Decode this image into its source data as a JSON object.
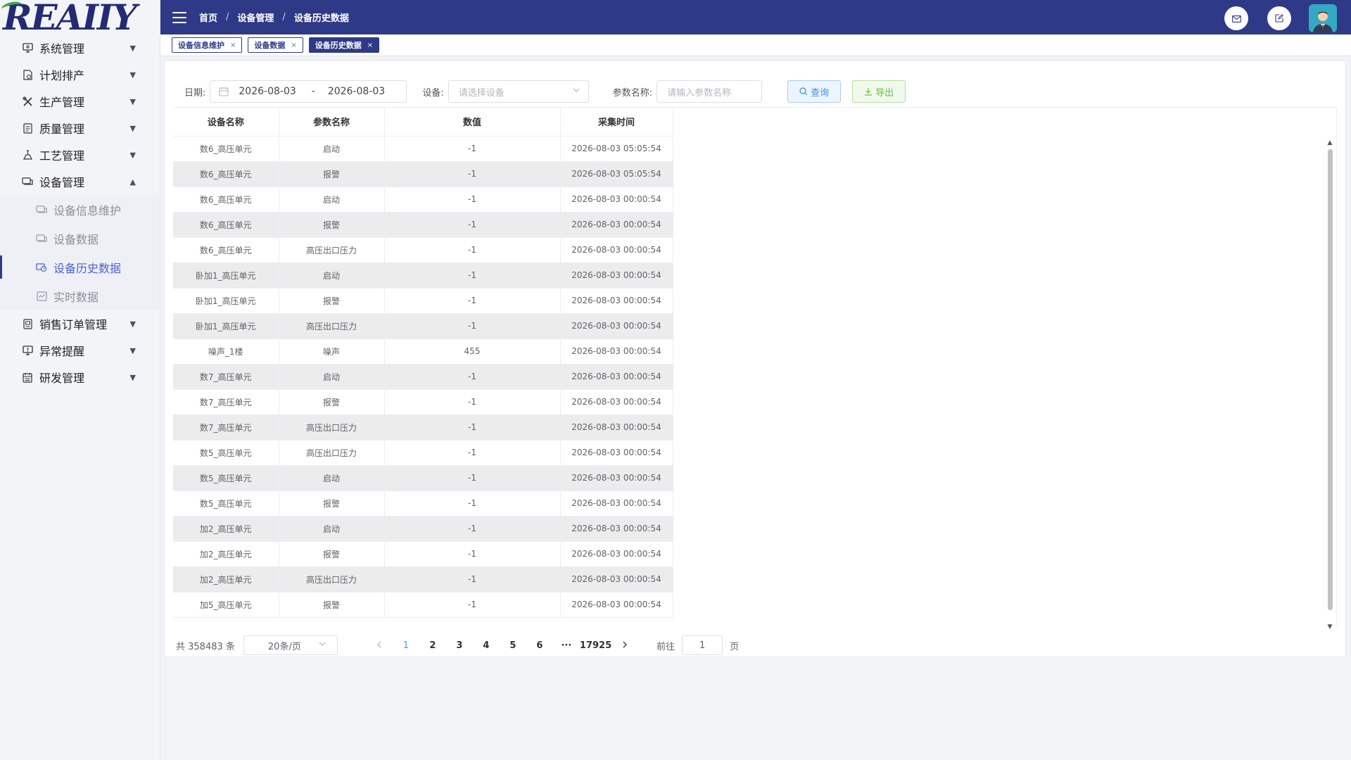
{
  "logo": {
    "text": "REAIIY"
  },
  "header": {
    "breadcrumb": [
      "首页",
      "设备管理",
      "设备历史数据"
    ],
    "separator": "/",
    "icons": [
      "mail-icon",
      "edit-icon",
      "user-avatar"
    ]
  },
  "sidebar": {
    "items": [
      {
        "label": "系统管理",
        "icon": "monitor-icon",
        "expanded": false
      },
      {
        "label": "计划排产",
        "icon": "document-icon",
        "expanded": false
      },
      {
        "label": "生产管理",
        "icon": "tools-icon",
        "expanded": false
      },
      {
        "label": "质量管理",
        "icon": "list-icon",
        "expanded": false
      },
      {
        "label": "工艺管理",
        "icon": "flask-icon",
        "expanded": false
      },
      {
        "label": "设备管理",
        "icon": "device-icon",
        "expanded": true
      },
      {
        "label": "销售订单管理",
        "icon": "order-icon",
        "expanded": false
      },
      {
        "label": "异常提醒",
        "icon": "alert-icon",
        "expanded": false
      },
      {
        "label": "研发管理",
        "icon": "calendar-icon",
        "expanded": false
      }
    ],
    "device_submenu": [
      {
        "label": "设备信息维护",
        "icon": "device-icon",
        "active": false
      },
      {
        "label": "设备数据",
        "icon": "device-icon",
        "active": false
      },
      {
        "label": "设备历史数据",
        "icon": "history-icon",
        "active": true
      },
      {
        "label": "实时数据",
        "icon": "chart-icon",
        "active": false
      }
    ]
  },
  "tags": [
    {
      "label": "设备信息维护",
      "active": false
    },
    {
      "label": "设备数据",
      "active": false
    },
    {
      "label": "设备历史数据",
      "active": true
    }
  ],
  "filters": {
    "date_label": "日期:",
    "date_start": "2026-08-03",
    "date_sep": "-",
    "date_end": "2026-08-03",
    "device_label": "设备:",
    "device_placeholder": "请选择设备",
    "param_label": "参数名称:",
    "param_placeholder": "请输入参数名称",
    "query_button": "查询",
    "export_button": "导出"
  },
  "table": {
    "columns": [
      "设备名称",
      "参数名称",
      "数值",
      "采集时间"
    ],
    "rows": [
      [
        "数6_高压单元",
        "启动",
        "-1",
        "2026-08-03 05:05:54"
      ],
      [
        "数6_高压单元",
        "报警",
        "-1",
        "2026-08-03 05:05:54"
      ],
      [
        "数6_高压单元",
        "启动",
        "-1",
        "2026-08-03 00:00:54"
      ],
      [
        "数6_高压单元",
        "报警",
        "-1",
        "2026-08-03 00:00:54"
      ],
      [
        "数6_高压单元",
        "高压出口压力",
        "-1",
        "2026-08-03 00:00:54"
      ],
      [
        "卧加1_高压单元",
        "启动",
        "-1",
        "2026-08-03 00:00:54"
      ],
      [
        "卧加1_高压单元",
        "报警",
        "-1",
        "2026-08-03 00:00:54"
      ],
      [
        "卧加1_高压单元",
        "高压出口压力",
        "-1",
        "2026-08-03 00:00:54"
      ],
      [
        "噪声_1楼",
        "噪声",
        "455",
        "2026-08-03 00:00:54"
      ],
      [
        "数7_高压单元",
        "启动",
        "-1",
        "2026-08-03 00:00:54"
      ],
      [
        "数7_高压单元",
        "报警",
        "-1",
        "2026-08-03 00:00:54"
      ],
      [
        "数7_高压单元",
        "高压出口压力",
        "-1",
        "2026-08-03 00:00:54"
      ],
      [
        "数5_高压单元",
        "高压出口压力",
        "-1",
        "2026-08-03 00:00:54"
      ],
      [
        "数5_高压单元",
        "启动",
        "-1",
        "2026-08-03 00:00:54"
      ],
      [
        "数5_高压单元",
        "报警",
        "-1",
        "2026-08-03 00:00:54"
      ],
      [
        "加2_高压单元",
        "启动",
        "-1",
        "2026-08-03 00:00:54"
      ],
      [
        "加2_高压单元",
        "报警",
        "-1",
        "2026-08-03 00:00:54"
      ],
      [
        "加2_高压单元",
        "高压出口压力",
        "-1",
        "2026-08-03 00:00:54"
      ],
      [
        "加5_高压单元",
        "报警",
        "-1",
        "2026-08-03 00:00:54"
      ]
    ]
  },
  "pagination": {
    "total_text": "共 358483 条",
    "page_size": "20条/页",
    "pages": [
      "1",
      "2",
      "3",
      "4",
      "5",
      "6",
      "···",
      "17925"
    ],
    "current_page": "1",
    "goto_label": "前往",
    "goto_value": "1",
    "page_suffix": "页"
  },
  "colors": {
    "header_bg": "#2e3a87",
    "accent": "#4a62d6",
    "query_btn": "#3f8de0",
    "export_btn": "#6bbe46"
  }
}
